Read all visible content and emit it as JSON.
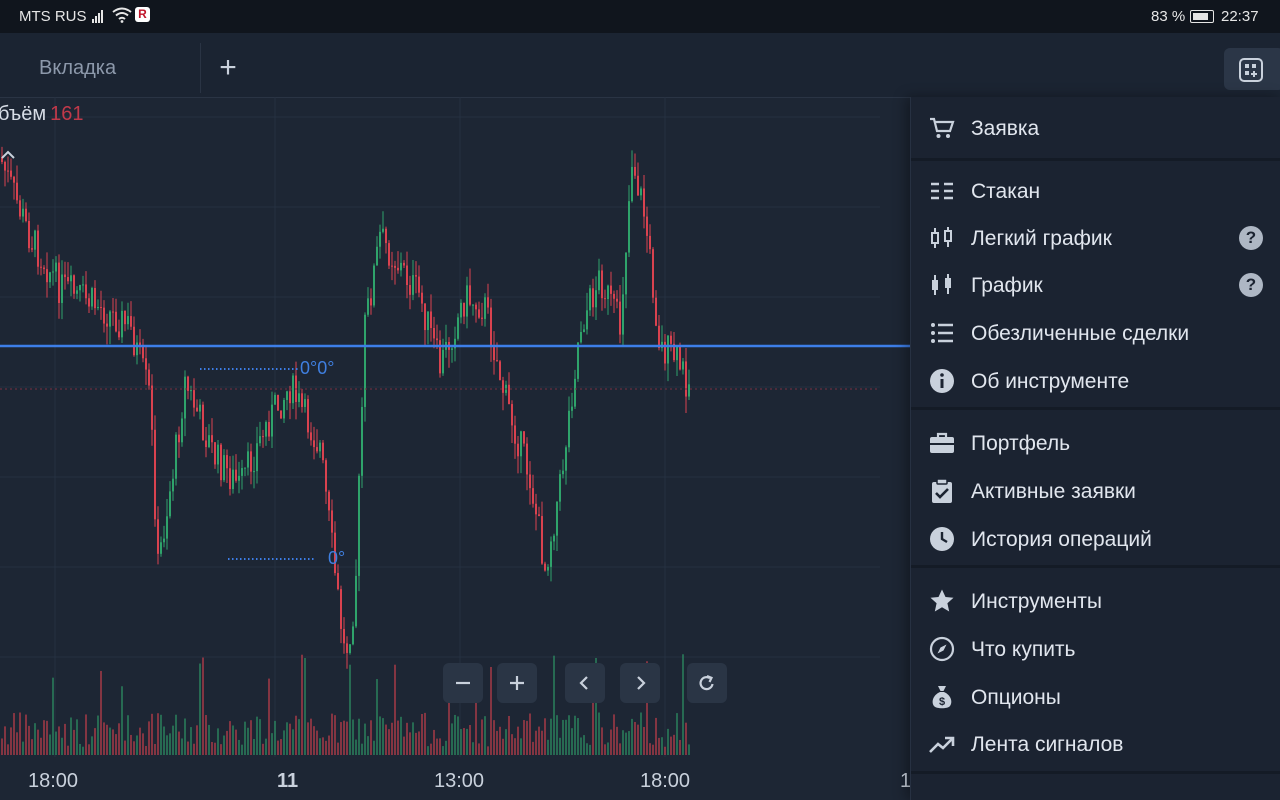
{
  "status_bar": {
    "carrier": "MTS RUS",
    "battery": "83 %",
    "time": "22:37"
  },
  "tabs": [
    {
      "label": "Вкладка"
    }
  ],
  "add_tab_label": "+",
  "chart": {
    "volume_label": "бъём",
    "volume_value": "161",
    "level_labels": [
      "0°0°",
      "0°"
    ],
    "x_axis": [
      "18:00",
      "11",
      "13:00",
      "18:00",
      "1"
    ]
  },
  "chart_controls": [
    "zoom-out",
    "zoom-in",
    "scroll-left",
    "scroll-right",
    "reset"
  ],
  "menu": {
    "items": [
      {
        "label": "Заявка",
        "icon": "cart-icon",
        "help": false
      },
      {
        "label": "Стакан",
        "icon": "order-book-icon",
        "help": false
      },
      {
        "label": "Легкий график",
        "icon": "candles-light-icon",
        "help": true
      },
      {
        "label": "График",
        "icon": "candles-icon",
        "help": true
      },
      {
        "label": "Обезличенные сделки",
        "icon": "list-icon",
        "help": false
      },
      {
        "label": "Об инструменте",
        "icon": "info-icon",
        "help": false
      },
      {
        "label": "Портфель",
        "icon": "briefcase-icon",
        "help": false
      },
      {
        "label": "Активные заявки",
        "icon": "clipboard-check-icon",
        "help": false
      },
      {
        "label": "История операций",
        "icon": "clock-icon",
        "help": false
      },
      {
        "label": "Инструменты",
        "icon": "star-icon",
        "help": false
      },
      {
        "label": "Что купить",
        "icon": "compass-icon",
        "help": false
      },
      {
        "label": "Опционы",
        "icon": "money-bag-icon",
        "help": false
      },
      {
        "label": "Лента сигналов",
        "icon": "trend-icon",
        "help": false
      }
    ],
    "help_mark": "?"
  },
  "colors": {
    "up": "#2fa36b",
    "down": "#d9424f",
    "price_line": "#3d7ee8",
    "accent_text": "#3f7fe0"
  }
}
